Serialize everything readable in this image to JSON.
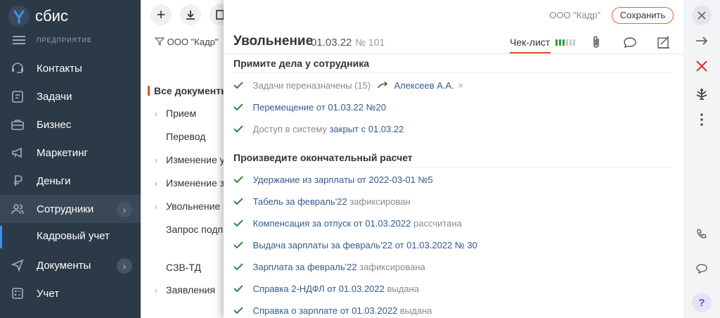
{
  "app": {
    "brand": "сбис",
    "section_label": "ПРЕДПРИЯТИЕ",
    "accent": "#e0502a"
  },
  "sidebar": {
    "items": [
      {
        "label": "Контакты",
        "icon": "contacts-icon"
      },
      {
        "label": "Задачи",
        "icon": "tasks-icon"
      },
      {
        "label": "Бизнес",
        "icon": "business-icon"
      },
      {
        "label": "Маркетинг",
        "icon": "megaphone-icon"
      },
      {
        "label": "Деньги",
        "icon": "money-icon"
      },
      {
        "label": "Сотрудники",
        "icon": "employees-icon",
        "active": true
      },
      {
        "label": "Документы",
        "icon": "documents-icon"
      },
      {
        "label": "Учет",
        "icon": "accounting-icon"
      }
    ],
    "sub_item": "Кадровый учет"
  },
  "middle": {
    "filter": "ООО \"Кадр\"",
    "folders": [
      "Все документы",
      "Прием",
      "Перевод",
      "Изменение у",
      "Изменение з",
      "Увольнение",
      "Запрос подп",
      "СЗВ-ТД",
      "Заявления"
    ]
  },
  "card": {
    "org": "ООО \"Кадр\"",
    "save_label": "Сохранить",
    "title": "Увольнение",
    "date": "01.03.22",
    "number": "№ 101",
    "checklist_tab": "Чек-лист",
    "checklist_progress": {
      "done": 3,
      "total": 6
    },
    "sections": [
      {
        "title": "Примите дела у сотрудника",
        "rows": [
          {
            "link": "",
            "gray": "Задачи переназначены (15)",
            "assignee": "Алексеев А.А."
          },
          {
            "link": "Перемещение от 01.03.22 №20",
            "gray": ""
          },
          {
            "gray_pre": "Доступ в систему",
            "link": "закрыт с 01.03.22"
          }
        ]
      },
      {
        "title": "Произведите окончательный расчет",
        "rows": [
          {
            "link": "Удержание из зарплаты от 2022-03-01 №5",
            "gray": ""
          },
          {
            "link": "Табель за февраль'22",
            "gray": "зафиксирован"
          },
          {
            "link": "Компенсация за отпуск от 01.03.2022",
            "gray": "рассчитана"
          },
          {
            "link": "Выдача зарплаты за февраль'22 от 01.03.2022 № 30",
            "gray": ""
          },
          {
            "link": "Зарплата за февраль'22",
            "gray": "зафиксирована"
          },
          {
            "link": "Справка 2-НДФЛ от 01.03.2022",
            "gray": "выдана"
          },
          {
            "link": "Справка о зарплате от 01.03.2022",
            "gray": "выдана"
          }
        ]
      }
    ]
  },
  "rail": {
    "help": "?"
  }
}
